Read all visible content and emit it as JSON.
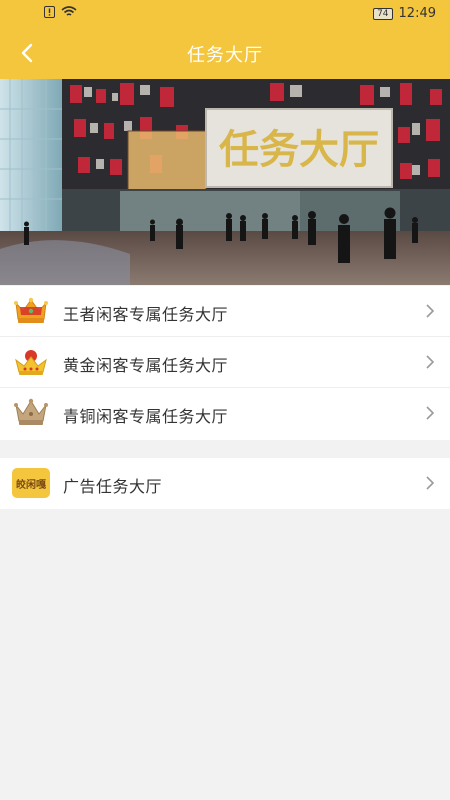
{
  "status": {
    "time": "12:49",
    "battery": "74"
  },
  "nav": {
    "title": "任务大厅",
    "back_icon": "back-arrow-icon"
  },
  "banner": {
    "sign_text": "任务大厅"
  },
  "sections": [
    {
      "items": [
        {
          "label": "王者闲客专属任务大厅",
          "icon": "king-crown-icon"
        },
        {
          "label": "黄金闲客专属任务大厅",
          "icon": "gold-crown-icon"
        },
        {
          "label": "青铜闲客专属任务大厅",
          "icon": "bronze-crown-icon"
        }
      ]
    },
    {
      "items": [
        {
          "label": "广告任务大厅",
          "icon": "ad-logo-icon",
          "icon_text": "皎闲嘎"
        }
      ]
    }
  ],
  "colors": {
    "accent": "#f4c63d",
    "background": "#f2f2f2"
  }
}
